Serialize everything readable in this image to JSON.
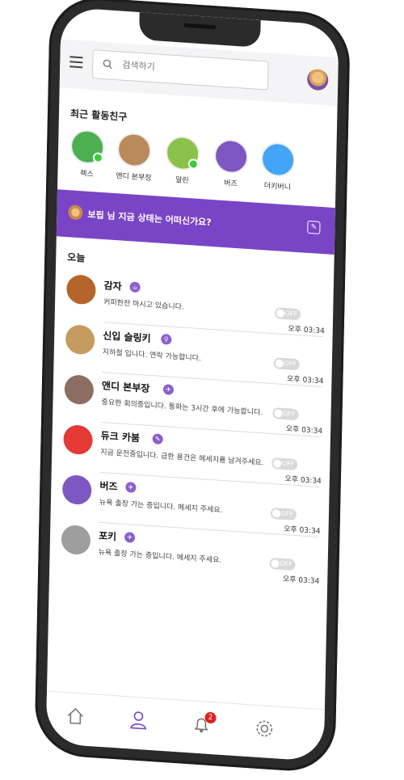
{
  "search": {
    "placeholder": "검색하기"
  },
  "recent": {
    "title": "최근 활동친구",
    "friends": [
      {
        "name": "렉스",
        "online": true,
        "color": "#4caf50"
      },
      {
        "name": "앤디 본부장",
        "online": false,
        "color": "#b98a5a"
      },
      {
        "name": "알린",
        "online": true,
        "color": "#8bc34a"
      },
      {
        "name": "버즈",
        "online": false,
        "color": "#7e57c2"
      },
      {
        "name": "더키버니",
        "online": false,
        "color": "#42a5f5"
      }
    ]
  },
  "status": {
    "text": "보핍 님 지금 상태는 어떠신가요?"
  },
  "today": {
    "title": "오늘",
    "items": [
      {
        "name": "감자",
        "message": "커피한잔 마시고 있습니다.",
        "toggle": "OFF",
        "time": "오후 03:34",
        "color": "#b5652a"
      },
      {
        "name": "신입 슬링키",
        "message": "지하철 입니다. 연락 가능합니다.",
        "toggle": "OFF",
        "time": "오후 03:34",
        "color": "#c59b5f"
      },
      {
        "name": "앤디 본부장",
        "message": "중요한 회의중입니다. 통화는 3시간 후에 가능합니다.",
        "toggle": "OFF",
        "time": "오후 03:34",
        "color": "#8d6e63"
      },
      {
        "name": "듀크 카붐",
        "message": "지금 운전중입니다. 급한 용건은 메세지를 남겨주세요.",
        "toggle": "OFF",
        "time": "오후 03:34",
        "color": "#e53935"
      },
      {
        "name": "버즈",
        "message": "뉴욕 출장 가는 중입니다. 메세지 주세요.",
        "toggle": "OFF",
        "time": "오후 03:34",
        "color": "#7e57c2"
      },
      {
        "name": "포키",
        "message": "뉴욕 출장 가는 중입니다. 메세지 주세요.",
        "toggle": "OFF",
        "time": "오후 03:34",
        "color": "#9e9e9e"
      }
    ]
  },
  "nav": {
    "notification_count": "2"
  },
  "colors": {
    "accent": "#7a44c6",
    "online": "#3ccb3c"
  }
}
